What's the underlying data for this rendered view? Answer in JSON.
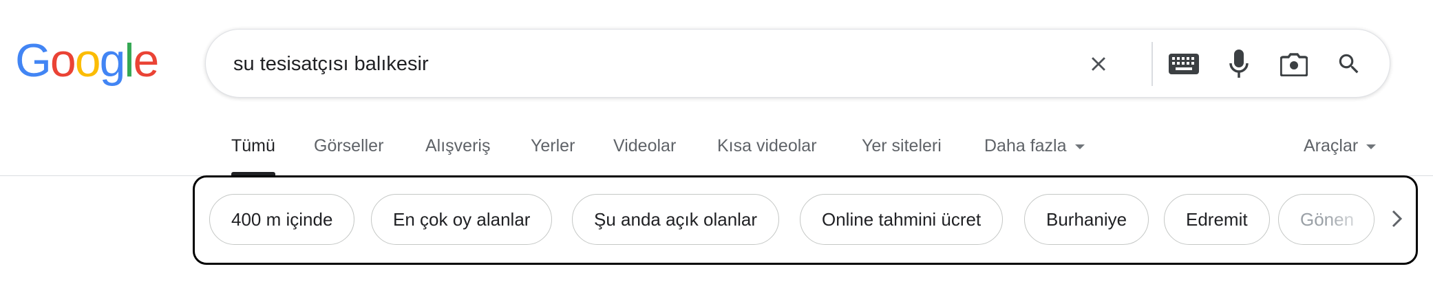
{
  "logo": {
    "letters": [
      "G",
      "o",
      "o",
      "g",
      "l",
      "e"
    ],
    "colors": [
      "#4285f4",
      "#ea4335",
      "#fbbc05",
      "#4285f4",
      "#34a853",
      "#ea4335"
    ]
  },
  "search": {
    "query": "su tesisatçısı balıkesir",
    "icons": [
      "clear-icon",
      "keyboard-icon",
      "microphone-icon",
      "google-lens-icon",
      "search-icon"
    ]
  },
  "tabs": {
    "items": [
      {
        "label": "Tümü",
        "active": true
      },
      {
        "label": "Görseller"
      },
      {
        "label": "Alışveriş"
      },
      {
        "label": "Yerler"
      },
      {
        "label": "Videolar"
      },
      {
        "label": "Kısa videolar"
      },
      {
        "label": "Yer siteleri"
      },
      {
        "label": "Daha fazla",
        "icon": "caret-down-icon"
      }
    ],
    "tools": {
      "label": "Araçlar",
      "icon": "caret-down-icon"
    }
  },
  "chips": {
    "items": [
      "400 m içinde",
      "En çok oy alanlar",
      "Şu anda açık olanlar",
      "Online tahmini ücret",
      "Burhaniye",
      "Edremit",
      "Gönen"
    ],
    "next_icon": "chevron-right-icon"
  },
  "colors": {
    "text": "#202124",
    "muted": "#5f6368",
    "border": "#dadce0",
    "frame": "#000000"
  }
}
